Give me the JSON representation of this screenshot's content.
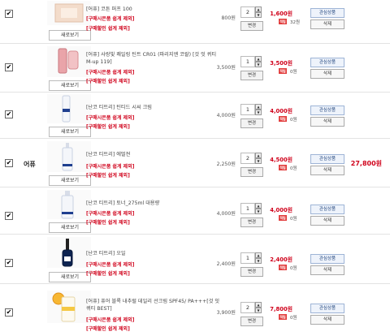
{
  "brand_label": "어퓨",
  "grand_total": "27,800원",
  "view_label": "새로보기",
  "change_label": "변경",
  "wish_label": "관심상품",
  "delete_label": "삭제",
  "point_badge": "적립",
  "colors": {
    "accent_red": "#d0021b",
    "badge_red": "#e23d3d"
  },
  "items": [
    {
      "name": "[어퓨] 코튼 퍼프 100",
      "coupon1": "[구매시은품 쉽게 제외]",
      "coupon2": "[구매할인 쉽게 제외]",
      "price": "800원",
      "qty": "2",
      "total": "1,600원",
      "points": "32원"
    },
    {
      "name": "[어퓨] 사랑빛 쾌일링 틴트 CR01 (파리지엔 코랄) [것 잇 퀴티 M-up 119]",
      "coupon1": "[구매시은품 쉽게 제외]",
      "coupon2": "[구매할인 쉽게 제외]",
      "price": "3,500원",
      "qty": "1",
      "total": "3,500원",
      "points": "0원"
    },
    {
      "name": "[난코 티트리] 틴티드 시씨 크림",
      "coupon1": "[구매시은품 쉽게 제외]",
      "coupon2": "[구매할인 쉽게 제외]",
      "price": "4,000원",
      "qty": "1",
      "total": "4,000원",
      "points": "0원"
    },
    {
      "name": "[난코 티트리] 에멀젼",
      "coupon1": "[구매시은품 쉽게 제외]",
      "coupon2": "[구매할인 쉽게 제외]",
      "price": "2,250원",
      "qty": "2",
      "total": "4,500원",
      "points": "0원"
    },
    {
      "name": "[난코 티트리] 토너_275ml 대용량",
      "coupon1": "[구매시은품 쉽게 제외]",
      "coupon2": "[구매할인 쉽게 제외]",
      "price": "4,000원",
      "qty": "1",
      "total": "4,000원",
      "points": "0원"
    },
    {
      "name": "[난코 티트리] 오일",
      "coupon1": "[구매시은품 쉽게 제외]",
      "coupon2": "[구매할인 쉽게 제외]",
      "price": "2,400원",
      "qty": "1",
      "total": "2,400원",
      "points": "0원"
    },
    {
      "name": "[어퓨] 퓨어 블록 내추럴 데일리 선크림 SPF45/ PA+++[것 잇 퀴티 BEST]",
      "coupon1": "[구매시은품 쉽게 제외]",
      "coupon2": "[구매할인 쉽게 제외]",
      "price": "3,900원",
      "qty": "2",
      "total": "7,800원",
      "points": "0원"
    }
  ]
}
